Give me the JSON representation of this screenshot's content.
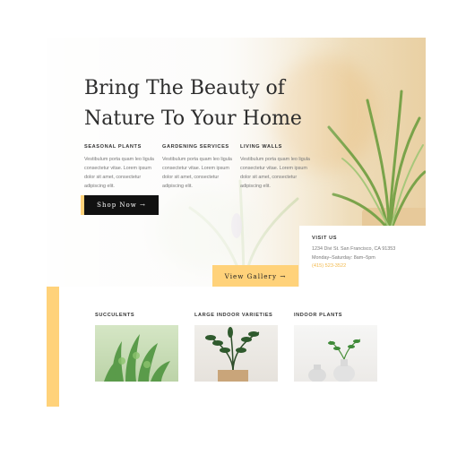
{
  "hero": {
    "title": "Bring The Beauty of Nature To Your Home",
    "columns": [
      {
        "heading": "SEASONAL PLANTS",
        "text": "Vestibulum porta quam leo ligula consectetur vitae. Lorem ipsum dolor sit amet, consectetur adipiscing elit."
      },
      {
        "heading": "GARDENING SERVICES",
        "text": "Vestibulum porta quam leo ligula consectetur vitae. Lorem ipsum dolor sit amet, consectetur adipiscing elit."
      },
      {
        "heading": "LIVING WALLS",
        "text": "Vestibulum porta quam leo ligula consectetur vitae. Lorem ipsum dolor sit amet, consectetur adipiscing elit."
      }
    ],
    "shop_button": "Shop Now →",
    "gallery_button": "View Gallery →"
  },
  "visit": {
    "heading": "VISIT US",
    "address": "1234 Divi St. San Francisco, CA 91353",
    "hours": "Monday–Saturday: 8am–5pm",
    "phone": "(415) 523-3522"
  },
  "categories": [
    {
      "label": "SUCCULENTS"
    },
    {
      "label": "LARGE INDOOR VARIETIES"
    },
    {
      "label": "INDOOR PLANTS"
    }
  ],
  "colors": {
    "accent": "#ffd27a",
    "dark": "#111111",
    "phone": "#f2b84b"
  },
  "icons": [
    "arrow-right-icon"
  ]
}
